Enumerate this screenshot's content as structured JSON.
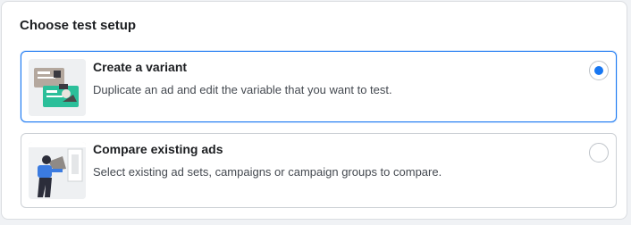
{
  "panel": {
    "title": "Choose test setup"
  },
  "options": [
    {
      "title": "Create a variant",
      "description": "Duplicate an ad and edit the variable that you want to test.",
      "selected": true,
      "icon": "variant-illustration-icon"
    },
    {
      "title": "Compare existing ads",
      "description": "Select existing ad sets, campaigns or campaign groups to compare.",
      "selected": false,
      "icon": "compare-illustration-icon"
    }
  ],
  "colors": {
    "accent": "#1877f2",
    "border": "#ccd0d5",
    "background": "#f0f2f5"
  }
}
